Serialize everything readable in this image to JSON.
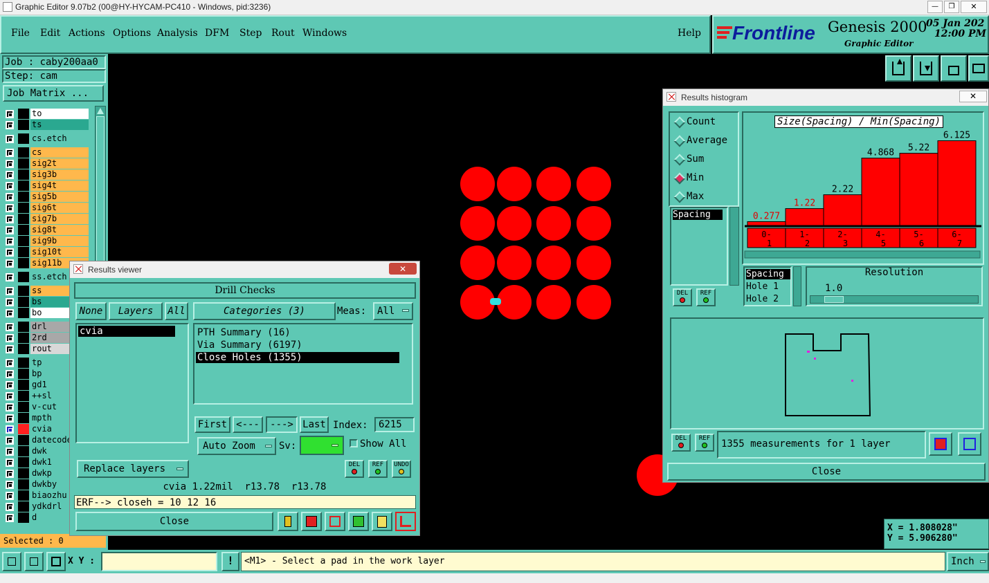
{
  "window": {
    "title": "Graphic Editor 9.07b2 (00@HY-HYCAM-PC410 - Windows, pid:3236)"
  },
  "menu": {
    "items": [
      "File",
      "Edit",
      "Actions",
      "Options",
      "Analysis",
      "DFM",
      "Step",
      "Rout",
      "Windows"
    ],
    "help": "Help"
  },
  "brand": {
    "logo": "Frontline",
    "product": "Genesis 2000",
    "subtitle": "Graphic Editor",
    "date": "05 Jan 202",
    "time": "12:00 PM"
  },
  "job": {
    "job_label": "Job : caby200aa0",
    "step_label": "Step: cam",
    "matrix_button": "Job Matrix ...",
    "selected": "Selected : 0"
  },
  "layers": [
    {
      "name": "to",
      "color": "#ffffff"
    },
    {
      "name": "ts",
      "color": "#2aa890"
    },
    {
      "name": "cs.etch",
      "color": "#5ec8b4"
    },
    {
      "name": "cs",
      "color": "#ffb84c"
    },
    {
      "name": "sig2t",
      "color": "#ffb84c"
    },
    {
      "name": "sig3b",
      "color": "#ffb84c"
    },
    {
      "name": "sig4t",
      "color": "#ffb84c"
    },
    {
      "name": "sig5b",
      "color": "#ffb84c"
    },
    {
      "name": "sig6t",
      "color": "#ffb84c"
    },
    {
      "name": "sig7b",
      "color": "#ffb84c"
    },
    {
      "name": "sig8t",
      "color": "#ffb84c"
    },
    {
      "name": "sig9b",
      "color": "#ffb84c"
    },
    {
      "name": "sig10t",
      "color": "#ffb84c"
    },
    {
      "name": "sig11b",
      "color": "#ffb84c"
    },
    {
      "name": "ss.etch",
      "color": "#5ec8b4"
    },
    {
      "name": "ss",
      "color": "#ffb84c"
    },
    {
      "name": "bs",
      "color": "#2aa890"
    },
    {
      "name": "bo",
      "color": "#ffffff"
    },
    {
      "name": "drl",
      "color": "#a8a8a8"
    },
    {
      "name": "2rd",
      "color": "#a8a8a8"
    },
    {
      "name": "rout",
      "color": "#d8d8d8"
    },
    {
      "name": "tp",
      "color": "#5ec8b4"
    },
    {
      "name": "bp",
      "color": "#5ec8b4"
    },
    {
      "name": "gd1",
      "color": "#5ec8b4"
    },
    {
      "name": "++sl",
      "color": "#5ec8b4"
    },
    {
      "name": "v-cut",
      "color": "#5ec8b4"
    },
    {
      "name": "mpth",
      "color": "#5ec8b4"
    },
    {
      "name": "cvia",
      "color": "#5ec8b4"
    },
    {
      "name": "datecode",
      "color": "#5ec8b4"
    },
    {
      "name": "dwk",
      "color": "#5ec8b4"
    },
    {
      "name": "dwk1",
      "color": "#5ec8b4"
    },
    {
      "name": "dwkp",
      "color": "#5ec8b4"
    },
    {
      "name": "dwkby",
      "color": "#5ec8b4"
    },
    {
      "name": "biaozhu",
      "color": "#5ec8b4"
    },
    {
      "name": "ydkdrl",
      "color": "#5ec8b4"
    },
    {
      "name": "d",
      "color": "#5ec8b4"
    }
  ],
  "results_viewer": {
    "title": "Results viewer",
    "header": "Drill Checks",
    "none_btn": "None",
    "layers_label": "Layers",
    "all_btn": "All",
    "categories_label": "Categories (3)",
    "meas_label": "Meas:",
    "meas_value": "All",
    "layers_list": [
      "cvia"
    ],
    "categories": [
      "PTH Summary (16)",
      "Via Summary (6197)",
      "Close Holes (1355)"
    ],
    "first": "First",
    "prev": "<---",
    "next": "--->",
    "last": "Last",
    "index_label": "Index:",
    "index_value": "6215",
    "auto_zoom": "Auto Zoom",
    "sv_label": "Sv:",
    "show_all": "Show All",
    "replace_layers": "Replace layers",
    "del": "DEL",
    "ref": "REF",
    "undo": "UNDO",
    "info": "cvia 1.22mil  r13.78  r13.78",
    "erf": "ERF--> closeh = 10 12 16",
    "close": "Close"
  },
  "histogram": {
    "title": "Results histogram",
    "modes": [
      "Count",
      "Average",
      "Sum",
      "Min",
      "Max"
    ],
    "selected_mode": "Min",
    "chart_title": "Size(Spacing) / Min(Spacing)",
    "list": [
      "Spacing"
    ],
    "params": [
      "Spacing",
      "Hole 1",
      "Hole 2"
    ],
    "resolution_label": "Resolution",
    "resolution_value": "1.0",
    "measurements": "1355 measurements for 1 layer",
    "close": "Close"
  },
  "chart_data": {
    "type": "bar",
    "title": "Size(Spacing) / Min(Spacing)",
    "categories": [
      "0-1",
      "1-2",
      "2-3",
      "4-5",
      "5-6",
      "6-7"
    ],
    "values": [
      0.277,
      1.22,
      2.22,
      4.868,
      5.22,
      6.125
    ],
    "value_labels": [
      "0.277",
      "1.22",
      "2.22",
      "4.868",
      "5.22",
      "6.125"
    ],
    "ylim": [
      0,
      7
    ]
  },
  "status": {
    "xy_label": "X Y :",
    "message": "<M1> - Select a pad in the work layer",
    "x": "X = 1.808028\"",
    "y": "Y = 5.906280\"",
    "units": "Inch"
  }
}
